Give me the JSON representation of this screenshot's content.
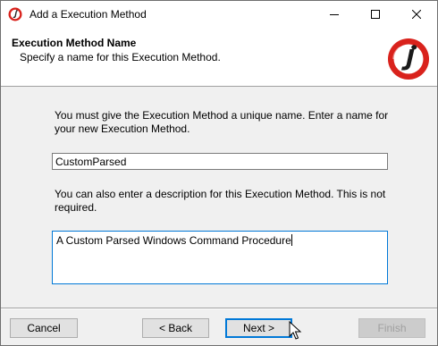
{
  "window": {
    "title": "Add a Execution Method",
    "icon": "app-logo-icon"
  },
  "header": {
    "title": "Execution Method Name",
    "subtitle": "Specify a name for this Execution Method."
  },
  "content": {
    "prompt_name": "You must give the Execution Method a unique name.  Enter a name for your new Execution Method.",
    "name_value": "CustomParsed",
    "prompt_description": "You can also enter a description for this Execution Method.  This is not required.",
    "description_value": "A Custom Parsed Windows Command Procedure"
  },
  "buttons": {
    "cancel": "Cancel",
    "back": "< Back",
    "next": "Next >",
    "finish": "Finish"
  },
  "colors": {
    "brand_red": "#d9221c",
    "focus_blue": "#0078d7"
  }
}
